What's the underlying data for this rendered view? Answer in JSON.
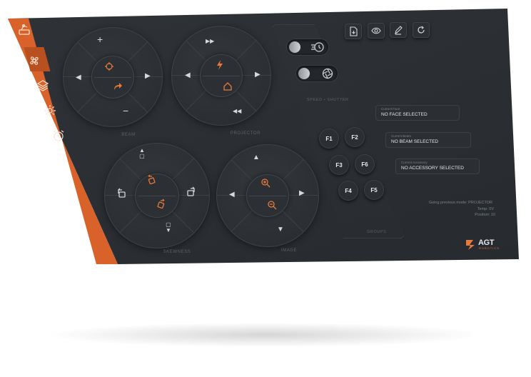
{
  "dials": {
    "beam": {
      "label": "BEAM"
    },
    "projector": {
      "label": "PROJECTOR"
    },
    "skewness": {
      "label": "SKEWNESS"
    },
    "image": {
      "label": "IMAGE"
    }
  },
  "panel": {
    "speed_label": "SPEED • SHUTTER",
    "groups_label": "GROUPS",
    "function_keys": [
      "F1",
      "F2",
      "F3",
      "F6",
      "F4",
      "F5"
    ]
  },
  "info": {
    "face_caption": "Current Face",
    "face_value": "NO FACE SELECTED",
    "beam_caption": "Current Beam",
    "beam_value": "NO BEAM SELECTED",
    "accessory_caption": "Current Accessory",
    "accessory_value": "NO ACCESSORY SELECTED"
  },
  "status": {
    "line1": "Going previous mode: PROJECTOR",
    "line2": "Temp: 0V",
    "line3": "Position: 10"
  },
  "brand": {
    "name": "AGT",
    "tagline": "ROBOTICS"
  },
  "colors": {
    "accent": "#d9622a",
    "background": "#2b2f33",
    "icon_accent": "#e67a3c"
  },
  "icons": {
    "sidebar": [
      "robot-icon",
      "fan-icon",
      "layers-icon",
      "gear-icon",
      "alarm-icon"
    ],
    "toolbar": [
      "save-file-icon",
      "eye-icon",
      "edit-icon",
      "refresh-icon"
    ]
  }
}
